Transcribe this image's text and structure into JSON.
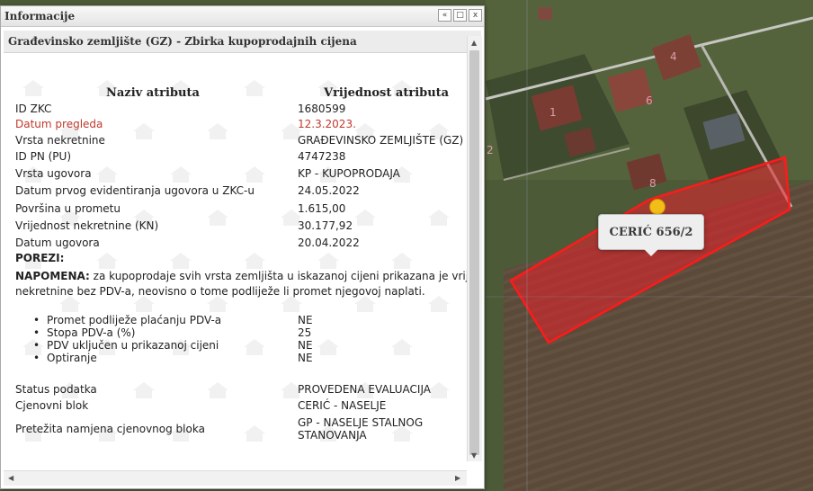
{
  "panel": {
    "title": "Informacije",
    "subheader": "Građevinsko zemljište (GZ) - Zbirka kupoprodajnih cijena",
    "controls": {
      "collapse": "«",
      "maximize": "□",
      "close": "x"
    }
  },
  "table": {
    "header_attr": "Naziv atributa",
    "header_value": "Vrijednost atributa",
    "rows": [
      {
        "key": "ID ZKC",
        "value": "1680599"
      },
      {
        "key": "Datum pregleda",
        "value": "12.3.2023."
      },
      {
        "key": "Vrsta nekretnine",
        "value": "GRAĐEVINSKO ZEMLJIŠTE (GZ)"
      },
      {
        "key": "ID PN (PU)",
        "value": "4747238"
      },
      {
        "key": "Vrsta ugovora",
        "value": "KP - KUPOPRODAJA"
      },
      {
        "key": "Datum prvog evidentiranja ugovora u ZKC-u",
        "value": "24.05.2022"
      },
      {
        "key": "Površina u prometu",
        "value": "1.615,00"
      },
      {
        "key": "Vrijednost nekretnine (KN)",
        "value": "30.177,92"
      },
      {
        "key": "Datum ugovora",
        "value": "20.04.2022"
      }
    ],
    "porezi_label": "POREZI:",
    "note_bold": "NAPOMENA:",
    "note_text": "za kupoprodaje svih vrsta zemljišta u iskazanoj cijeni prikazana je vrijednost",
    "note_text2": "nekretnine bez PDV-a, neovisno o tome podliježe li promet njegovoj naplati.",
    "bullets": [
      {
        "key": "Promet podliježe plaćanju PDV-a",
        "value": "NE"
      },
      {
        "key": "Stopa PDV-a (%)",
        "value": "25"
      },
      {
        "key": "PDV uključen u prikazanoj cijeni",
        "value": "NE"
      },
      {
        "key": "Optiranje",
        "value": "NE"
      }
    ],
    "rows2": [
      {
        "key": "Status podatka",
        "value": "PROVEDENA EVALUACIJA"
      },
      {
        "key": "Cjenovni blok",
        "value": "CERIĆ - NASELJE"
      },
      {
        "key": "Pretežita namjena cjenovnog bloka",
        "value": "GP - NASELJE STALNOG",
        "value2": "STANOVANJA"
      }
    ]
  },
  "map": {
    "tooltip": "CERIĆ 656/2",
    "house_numbers": [
      "4",
      "1",
      "6",
      "8",
      "2"
    ],
    "parcel_color": "#e8212a",
    "marker_color": "#f2bd16"
  }
}
